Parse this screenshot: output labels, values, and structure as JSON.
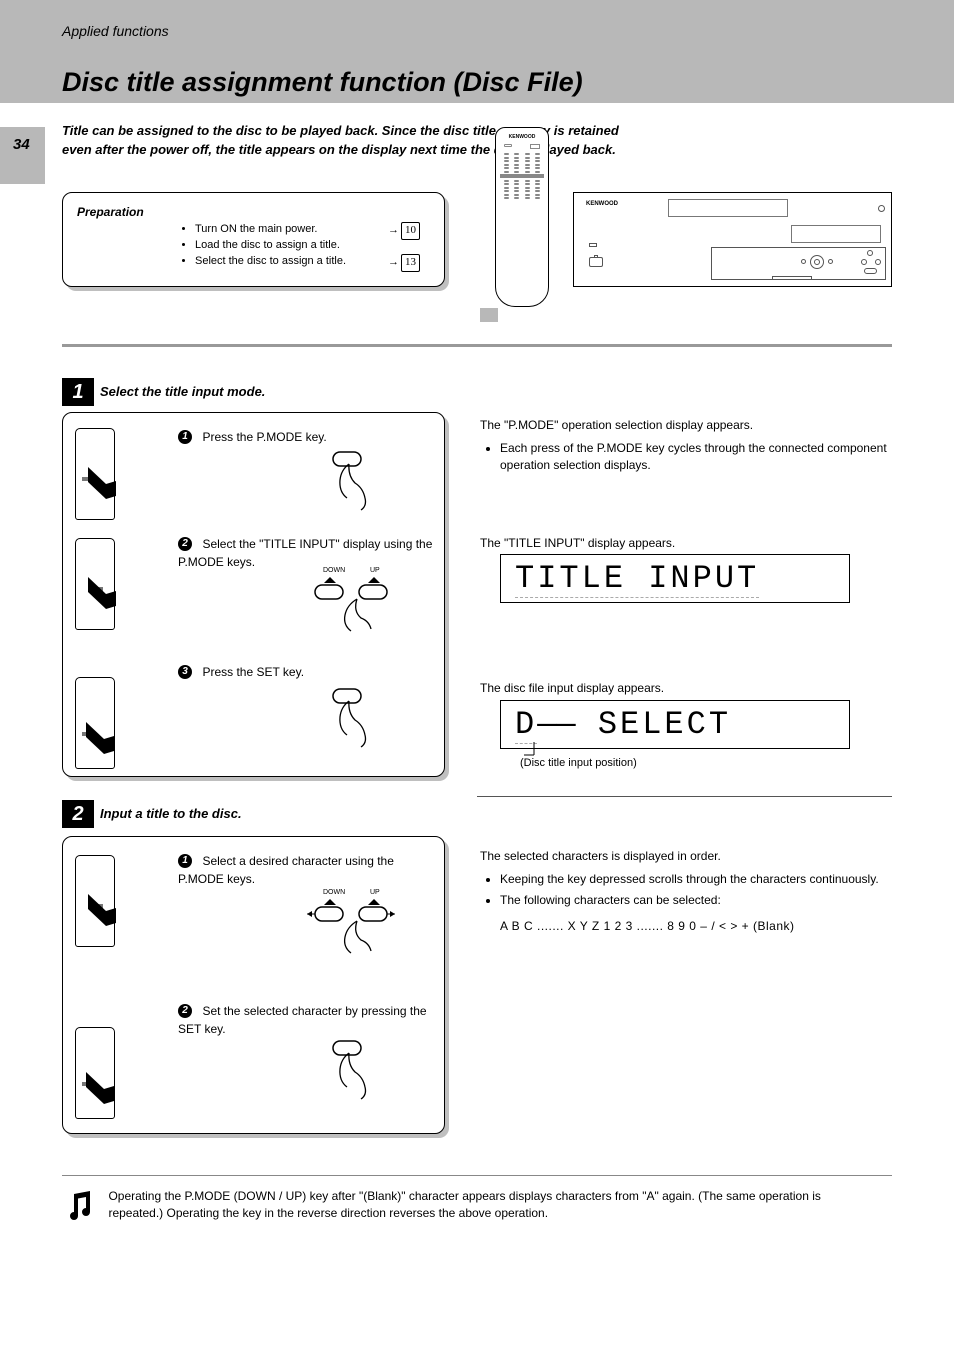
{
  "page_number": "34",
  "section": "Applied functions",
  "feature_title": "Disc title assignment function (Disc File)",
  "preface": "Title can be assigned to the disc to be played back. Since the disc title memory is retained even after the power off, the title appears on the display next time the disc is played back.",
  "preparation": {
    "heading": "Preparation",
    "items": [
      {
        "text": "Turn ON the main power.",
        "ref": "10"
      },
      {
        "text": "Load the disc to assign a title."
      },
      {
        "text": "Select the disc to assign a title.",
        "ref": "13"
      }
    ]
  },
  "steps": {
    "step1": {
      "label": "Select the title input mode.",
      "substeps": [
        {
          "n": "1",
          "text": "Press the P.MODE key."
        },
        {
          "n": "2",
          "text": "Select the \"TITLE INPUT\" display using the P.MODE keys.",
          "tags": [
            "DOWN",
            "UP"
          ]
        },
        {
          "n": "3",
          "text": "Press the SET key."
        }
      ]
    },
    "step2": {
      "label": "Input a title to the disc.",
      "substeps": [
        {
          "n": "1",
          "text": "Select a desired character using the P.MODE keys.",
          "tags": [
            "DOWN",
            "UP"
          ]
        },
        {
          "n": "2",
          "text": "Set the selected character by pressing the SET key."
        }
      ]
    }
  },
  "right": {
    "block1_title": "The \"P.MODE\" operation selection display appears.",
    "block1_items": [
      "Each press of the P.MODE key cycles through the connected component operation selection displays."
    ],
    "lcd1_caption": "The \"TITLE INPUT\" display appears.",
    "lcd1": "TITLE INPUT",
    "lcd2_caption": "The disc file input display appears.",
    "lcd2_left": "D",
    "lcd2_right": " SELECT",
    "lcd2_sub": "(Disc title input position)",
    "block2_title": "The selected characters is displayed in order.",
    "block2_items": [
      "Keeping the key depressed scrolls through the characters continuously.",
      "The following characters can be selected:"
    ],
    "characters_line": "A B C ....... X Y Z 1 2 3 ....... 8 9 0 – / < > + (Blank)"
  },
  "footer": "Operating the P.MODE (DOWN / UP) key after \"(Blank)\" character appears displays characters from \"A\" again. (The same operation is repeated.) Operating the key in the reverse direction reverses the above operation.",
  "brand": "KENWOOD"
}
